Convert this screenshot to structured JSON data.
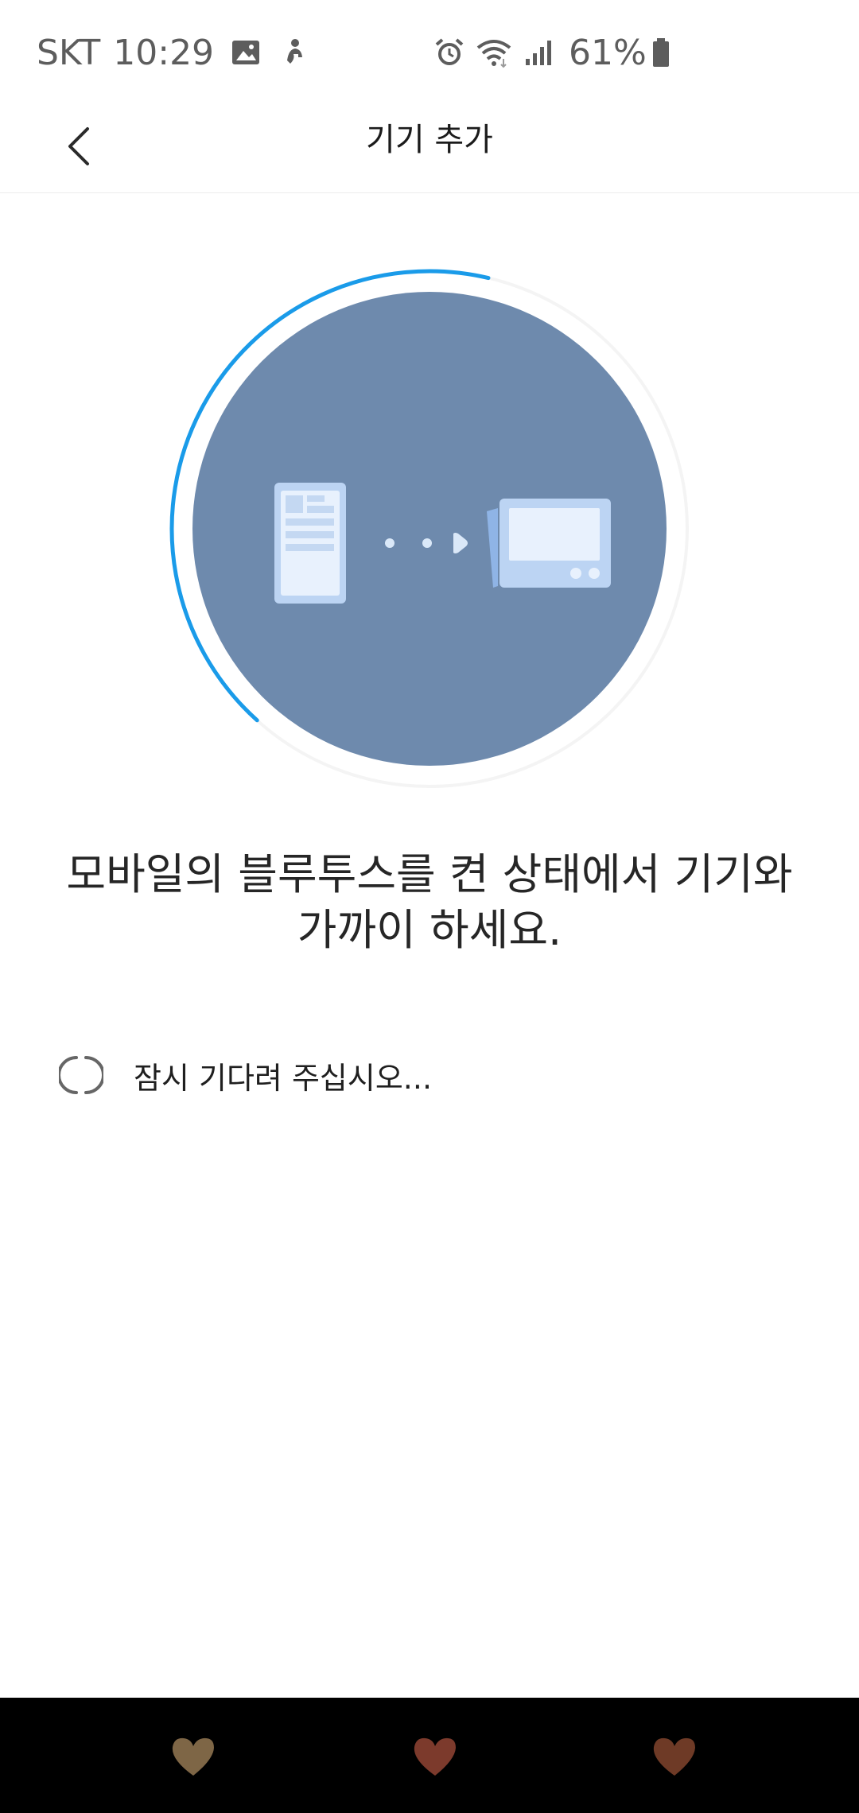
{
  "status_bar": {
    "carrier": "SKT",
    "time": "10:29",
    "battery_percent": "61%",
    "icons": [
      "gallery-icon",
      "figure-icon",
      "alarm-icon",
      "wifi-icon",
      "signal-icon",
      "battery-icon"
    ]
  },
  "header": {
    "title": "기기 추가",
    "back_icon": "chevron-left-icon"
  },
  "illustration": {
    "progress": 0.42,
    "ring_color": "#1a9be9",
    "circle_color": "#6e8aad",
    "icons": [
      "phone-icon",
      "arrow-dots-icon",
      "device-icon"
    ]
  },
  "instruction": {
    "line1": "모바일의 블루투스를 켠 상태에서 기기와",
    "line2": "가까이 하세요."
  },
  "status": {
    "waiting_text": "잠시 기다려 주십시오..."
  },
  "bottom_bar": {
    "icons": [
      {
        "name": "heart-icon",
        "color": "#7e6646"
      },
      {
        "name": "heart-icon",
        "color": "#7c3a2c"
      },
      {
        "name": "heart-icon",
        "color": "#6e3a26"
      }
    ]
  }
}
